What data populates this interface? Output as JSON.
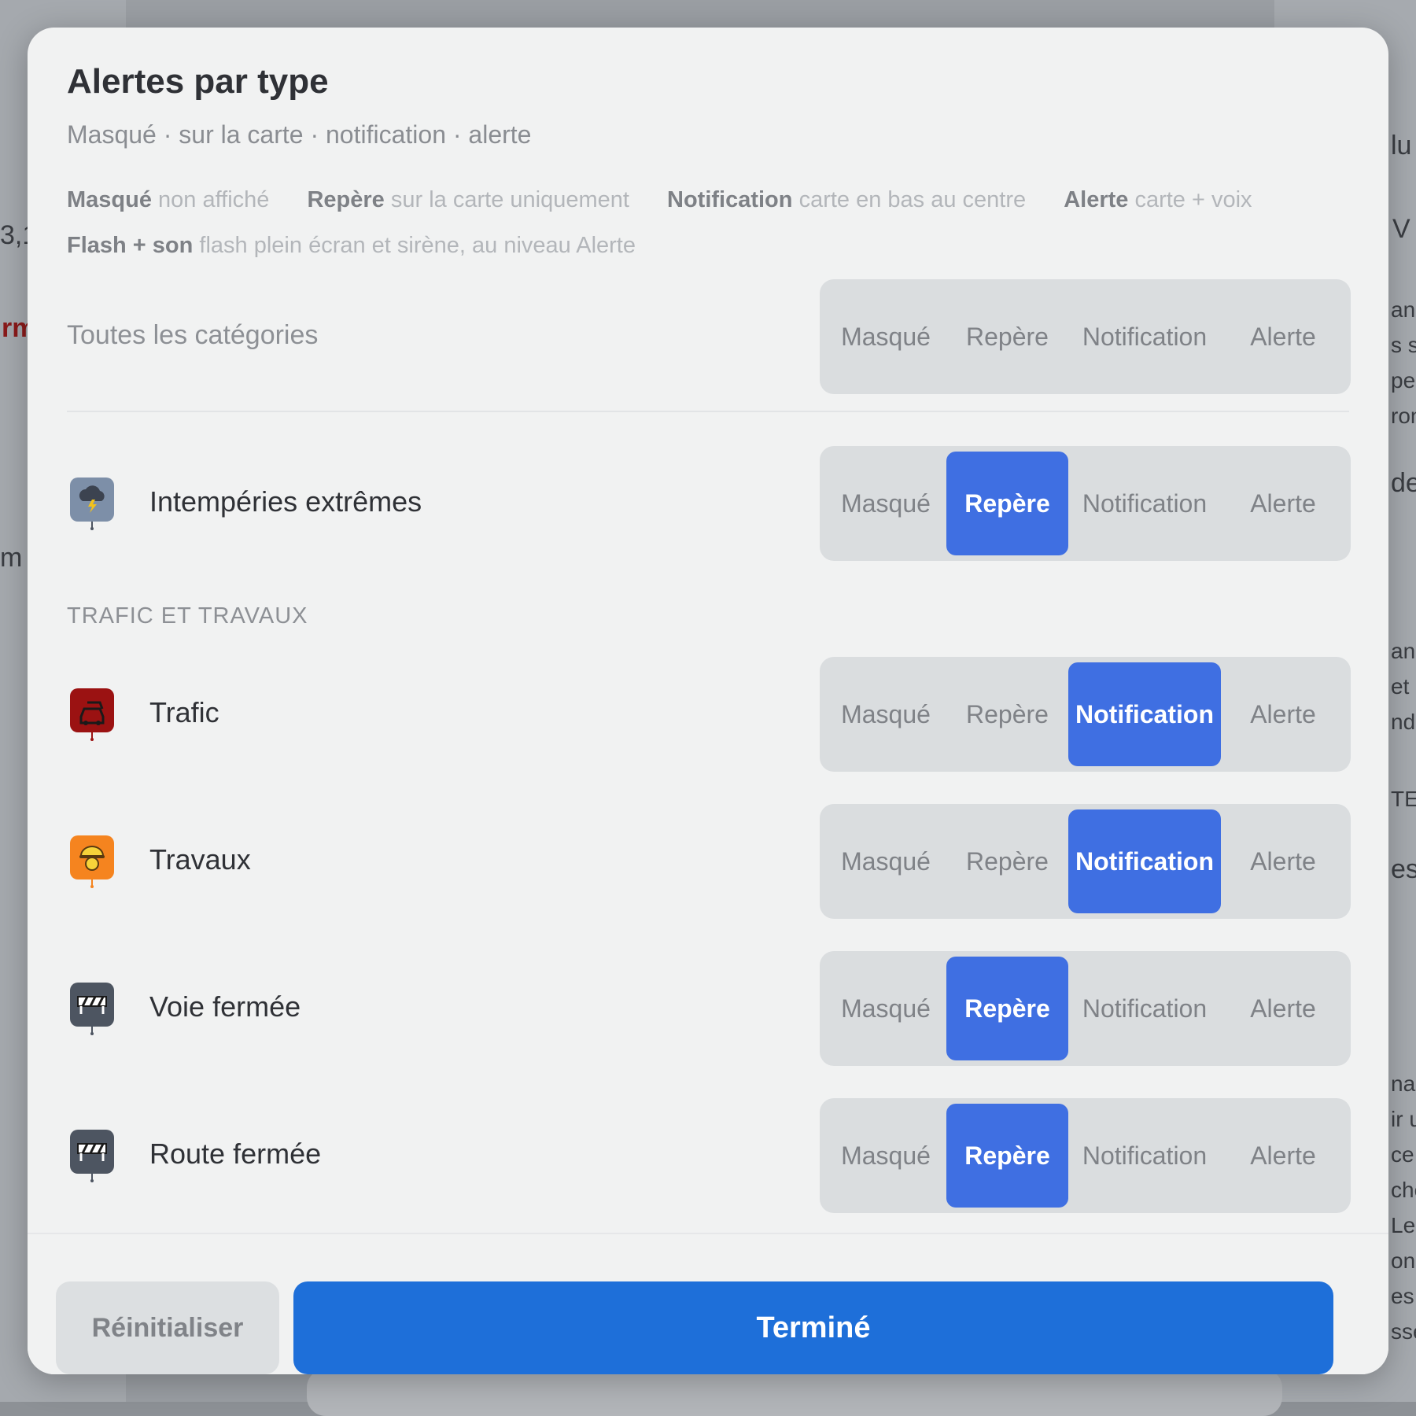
{
  "background": {
    "fragments": [
      "rm",
      "3,1",
      "m",
      "lu",
      "V",
      "an",
      "s s",
      "pe",
      "ron",
      "de",
      "an",
      "et",
      "nd",
      "TES",
      "es",
      "nac",
      "ir u",
      "ce",
      "che",
      "Le",
      "ons",
      "es l",
      "sse"
    ]
  },
  "modal": {
    "title": "Alertes par type",
    "subtitle": "Masqué · sur la carte · notification · alerte",
    "legend": [
      {
        "term": "Masqué",
        "desc": "non affiché"
      },
      {
        "term": "Repère",
        "desc": "sur la carte uniquement"
      },
      {
        "term": "Notification",
        "desc": "carte en bas au centre"
      },
      {
        "term": "Alerte",
        "desc": "carte + voix"
      },
      {
        "term": "Flash + son",
        "desc": "flash plein écran et sirène, au niveau Alerte"
      }
    ],
    "all_categories": {
      "label": "Toutes les catégories",
      "options": [
        "Masqué",
        "Repère",
        "Notification",
        "Alerte"
      ],
      "selected": null
    },
    "section_traffic": "TRAFIC ET TRAVAUX",
    "categories": [
      {
        "name": "Intempéries extrêmes",
        "icon": "storm-icon",
        "icon_color": "#7d8fa8",
        "selected": "Repère",
        "options": [
          "Masqué",
          "Repère",
          "Notification",
          "Alerte"
        ]
      },
      {
        "name": "Trafic",
        "icon": "traffic-car-icon",
        "icon_color": "#9b1212",
        "selected": "Notification",
        "options": [
          "Masqué",
          "Repère",
          "Notification",
          "Alerte"
        ]
      },
      {
        "name": "Travaux",
        "icon": "worker-helmet-icon",
        "icon_color": "#f5841f",
        "selected": "Notification",
        "options": [
          "Masqué",
          "Repère",
          "Notification",
          "Alerte"
        ]
      },
      {
        "name": "Voie fermée",
        "icon": "barrier-icon",
        "icon_color": "#4d5561",
        "selected": "Repère",
        "options": [
          "Masqué",
          "Repère",
          "Notification",
          "Alerte"
        ]
      },
      {
        "name": "Route fermée",
        "icon": "barrier-icon",
        "icon_color": "#4d5561",
        "selected": "Repère",
        "options": [
          "Masqué",
          "Repère",
          "Notification",
          "Alerte"
        ]
      }
    ],
    "footer": {
      "reset_label": "Réinitialiser",
      "done_label": "Terminé"
    }
  },
  "colors": {
    "accent": "#3f6fe2",
    "primary_button": "#1e6fd9"
  }
}
